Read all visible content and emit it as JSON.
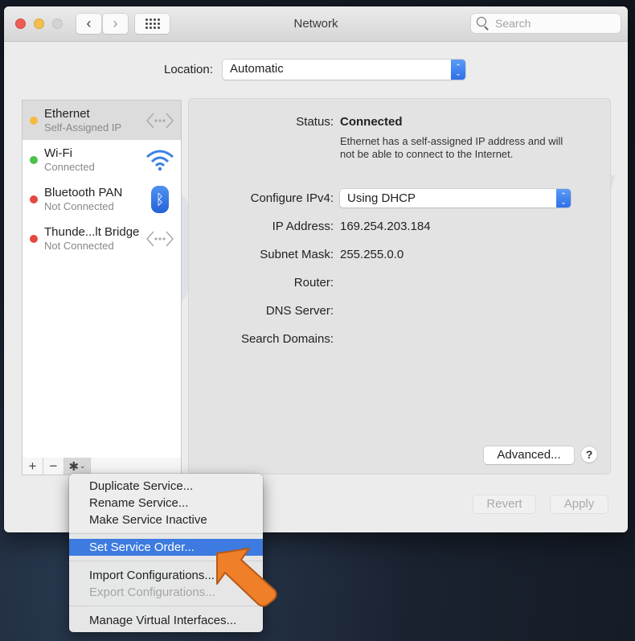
{
  "window": {
    "title": "Network",
    "search": {
      "placeholder": "Search",
      "value": ""
    },
    "nav": {
      "back_icon": "chevron-left-icon",
      "forward_icon": "chevron-right-icon",
      "grid_icon": "show-all-grid-icon"
    }
  },
  "location": {
    "label": "Location:",
    "value": "Automatic"
  },
  "services": [
    {
      "name": "Ethernet",
      "status": "Self-Assigned IP",
      "dot_color": "#f5b942",
      "icon": "ethernet-icon",
      "selected": true
    },
    {
      "name": "Wi-Fi",
      "status": "Connected",
      "dot_color": "#4cc24a",
      "icon": "wifi-icon",
      "selected": false
    },
    {
      "name": "Bluetooth PAN",
      "status": "Not Connected",
      "dot_color": "#e5483f",
      "icon": "bluetooth-icon",
      "selected": false
    },
    {
      "name": "Thunde...lt Bridge",
      "status": "Not Connected",
      "dot_color": "#e5483f",
      "icon": "ethernet-icon",
      "selected": false
    }
  ],
  "toolbar": {
    "add": "+",
    "remove": "−",
    "gear": "✱",
    "gear_chevron": "⌄"
  },
  "details": {
    "status_label": "Status:",
    "status_value": "Connected",
    "status_note": "Ethernet has a self-assigned IP address and will not be able to connect to the Internet.",
    "configure_label": "Configure IPv4:",
    "configure_value": "Using DHCP",
    "ip_label": "IP Address:",
    "ip_value": "169.254.203.184",
    "subnet_label": "Subnet Mask:",
    "subnet_value": "255.255.0.0",
    "router_label": "Router:",
    "router_value": "",
    "dns_label": "DNS Server:",
    "dns_value": "",
    "domains_label": "Search Domains:",
    "domains_value": ""
  },
  "buttons": {
    "advanced": "Advanced...",
    "help": "?",
    "revert": "Revert",
    "apply": "Apply"
  },
  "menu": {
    "items": [
      {
        "label": "Duplicate Service...",
        "state": "normal"
      },
      {
        "label": "Rename Service...",
        "state": "normal"
      },
      {
        "label": "Make Service Inactive",
        "state": "normal"
      },
      {
        "label": "Set Service Order...",
        "state": "highlighted"
      },
      {
        "label": "Import Configurations...",
        "state": "normal"
      },
      {
        "label": "Export Configurations...",
        "state": "disabled"
      },
      {
        "label": "Manage Virtual Interfaces...",
        "state": "normal"
      }
    ]
  },
  "annotation": {
    "arrow_color": "#f07f2a"
  },
  "watermark": {
    "text": "PC risk.com"
  }
}
